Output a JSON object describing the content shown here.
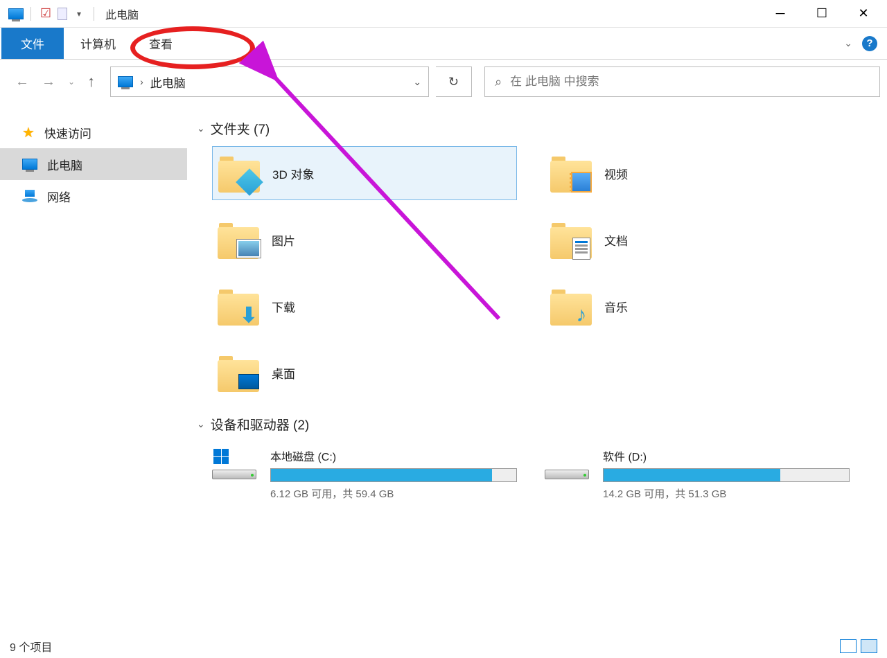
{
  "titlebar": {
    "title": "此电脑"
  },
  "ribbon": {
    "tabs": [
      "文件",
      "计算机",
      "查看"
    ],
    "active_index": 0
  },
  "nav": {
    "breadcrumb": "此电脑",
    "search_placeholder": "在 此电脑 中搜索"
  },
  "sidebar": {
    "items": [
      {
        "label": "快速访问",
        "icon": "star"
      },
      {
        "label": "此电脑",
        "icon": "pc",
        "selected": true
      },
      {
        "label": "网络",
        "icon": "network"
      }
    ]
  },
  "sections": {
    "folders": {
      "title": "文件夹 (7)",
      "items": [
        {
          "label": "3D 对象",
          "icon": "3d",
          "selected": true
        },
        {
          "label": "视频",
          "icon": "video"
        },
        {
          "label": "图片",
          "icon": "pictures"
        },
        {
          "label": "文档",
          "icon": "documents"
        },
        {
          "label": "下载",
          "icon": "downloads"
        },
        {
          "label": "音乐",
          "icon": "music"
        },
        {
          "label": "桌面",
          "icon": "desktop"
        }
      ]
    },
    "drives": {
      "title": "设备和驱动器 (2)",
      "items": [
        {
          "name": "本地磁盘 (C:)",
          "free_text": "6.12 GB 可用，共 59.4 GB",
          "fill_pct": 90,
          "has_winlogo": true
        },
        {
          "name": "软件 (D:)",
          "free_text": "14.2 GB 可用，共 51.3 GB",
          "fill_pct": 72,
          "has_winlogo": false
        }
      ]
    }
  },
  "statusbar": {
    "text": "9 个项目"
  }
}
